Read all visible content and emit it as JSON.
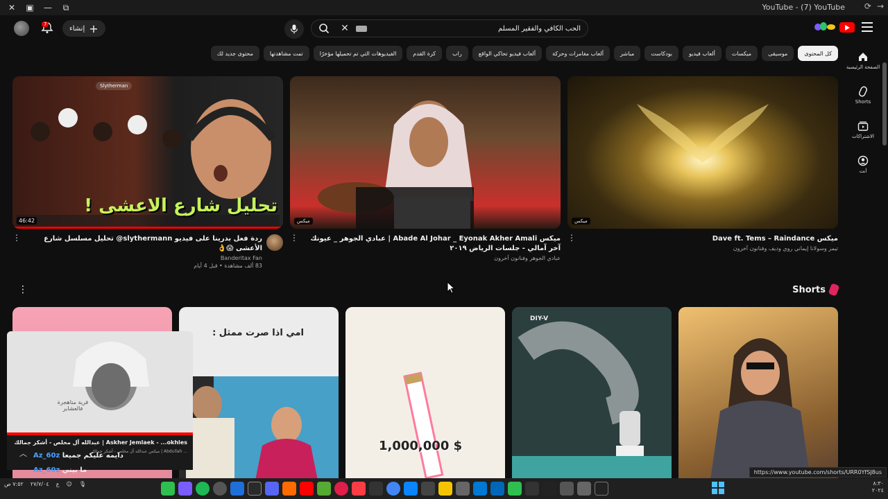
{
  "window": {
    "title": "YouTube - (7) YouTube"
  },
  "header": {
    "search_value": "الحب الكافي والفقير المسلم",
    "create_label": "إنشاء",
    "notification_count": "7"
  },
  "sidebar": {
    "items": [
      {
        "label": "الصفحة الرئيسية",
        "icon": "home-icon"
      },
      {
        "label": "Shorts",
        "icon": "shorts-icon"
      },
      {
        "label": "الاشتراكات",
        "icon": "subscriptions-icon"
      },
      {
        "label": "أنت",
        "icon": "you-icon"
      }
    ]
  },
  "chips": [
    {
      "label": "كل المحتوى",
      "active": true
    },
    {
      "label": "موسيقى"
    },
    {
      "label": "ميكسات"
    },
    {
      "label": "ألعاب فيديو"
    },
    {
      "label": "بودكاست"
    },
    {
      "label": "مباشر"
    },
    {
      "label": "ألعاب مغامرات وحركة"
    },
    {
      "label": "ألعاب فيديو تحاكي الواقع"
    },
    {
      "label": "راب"
    },
    {
      "label": "كرة القدم"
    },
    {
      "label": "الفيديوهات التي تم تحميلها مؤخرًا"
    },
    {
      "label": "تمت مشاهدتها"
    },
    {
      "label": "محتوى جديد لك"
    }
  ],
  "videos": [
    {
      "title": "ميكس Dave ft. Tems – Raindance",
      "sub1": "تيمز وسولانا إيماني روي وديف وفنانون آخرون",
      "sub2": "",
      "badge": "ميكس",
      "duration": ""
    },
    {
      "title": "ميكس Abade Al Johar _ Eyonak Akher Amali | عبادي الجوهر _ عيونك آخر آمالي - جلسات الرياض ٢٠١٩",
      "sub1": "عبادي الجوهر وفنانون آخرون",
      "sub2": "",
      "badge": "ميكس",
      "duration": ""
    },
    {
      "title": "ردة فعل بدرينا على فيديو slythermann@ تحليل مسلسل شارع الأعشى 😱👌",
      "sub1": "Banderitax Fan",
      "sub2": "83 ألف مشاهدة • قبل 4 أيام",
      "badge": "",
      "duration": "46:42",
      "thumb_text": "تحليل شارع الاعشى !",
      "thumb_channel": "Slytherman"
    }
  ],
  "shorts_section": {
    "title": "Shorts",
    "items": [
      {
        "caption": ""
      },
      {
        "caption": "DIY-V"
      },
      {
        "caption": "1,000,000 $"
      },
      {
        "caption": "امي اذا صرت ممثل :"
      },
      {
        "caption": ""
      }
    ]
  },
  "mini_player": {
    "title": "عبدالله آل مخلص - أشكر جمالك | Askher Jemlaek - ...okhles",
    "subtitle": "ميكس عبدالله آل مخلص - أشكر جمالك | Abdullah ...",
    "overlay_text": "قرية متاهجرة فالعشاير"
  },
  "chat": [
    {
      "user": "Az_60z",
      "text": "دايمه عليكم جميعا"
    },
    {
      "user": "Az_60z",
      "text": "ما بيني"
    }
  ],
  "status_url": "https://www.youtube.com/shorts/URR0YfSJ8us",
  "taskbar": {
    "time": "٧:٥٢ ص",
    "date": "٢٧/٧/٠٤",
    "lang": "ع",
    "corner_line1": "٨:٣٠",
    "corner_line2": "٢٠٢٤"
  }
}
